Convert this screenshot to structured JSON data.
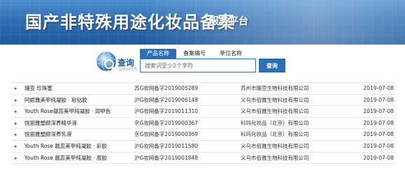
{
  "header": {
    "title": "国产非特殊用途化妆品备案",
    "subtitle": "服务平台"
  },
  "logo": {
    "text": "查询",
    "sub": "Search",
    "icon": "globe-magnifier-icon"
  },
  "search": {
    "tabs": [
      {
        "label": "产品名称",
        "active": true
      },
      {
        "label": "备案编号",
        "active": false
      },
      {
        "label": "单位名称",
        "active": false
      }
    ],
    "placeholder": "搜索词至少2个字符",
    "value": "",
    "button_label": "查询"
  },
  "colors": {
    "banner": "#2f6fb3",
    "accent": "#2d6fb5",
    "bullet": "#c0262c"
  },
  "results": [
    {
      "name": "珊亚 珍珠蜜",
      "no": "苏G妆网备字2019005289",
      "corp": "苏州市珊亚生物科技有限公司",
      "date": "2019-07-08"
    },
    {
      "name": "阿妮雅美甲纯凝胶 · 粘钻胶",
      "no": "沪G妆网备字2019006148",
      "corp": "义乌市佰雅生物科技有限公司",
      "date": "2019-07-08"
    },
    {
      "name": "Youth Rose靓蕊美甲纯凝胶 · 润甲色",
      "no": "沪G妆网备字2019011310",
      "corp": "义乌市佰雅生物科技有限公司",
      "date": "2019-07-08"
    },
    {
      "name": "悦丽雅塑颜深养精华液",
      "no": "京G妆网备字2019000367",
      "corp": "科玛化妆品（北京）有限公司",
      "date": "2019-07-08"
    },
    {
      "name": "悦丽雅塑颜深养乳液",
      "no": "京G妆网备字2019000369",
      "corp": "科玛化妆品（北京）有限公司",
      "date": "2019-07-08"
    },
    {
      "name": "Youth Rose 靓蕊美甲纯凝胶 · 彩胶",
      "no": "沪G妆网备字2019011580",
      "corp": "义乌市佰雅生物科技有限公司",
      "date": "2019-07-08"
    },
    {
      "name": "Youth Rose 靓蕊美甲纯凝胶 · 底胶",
      "no": "沪G妆网备字2019001848",
      "corp": "义乌市佰雅生物科技有限公司",
      "date": "2019-07-08"
    }
  ]
}
